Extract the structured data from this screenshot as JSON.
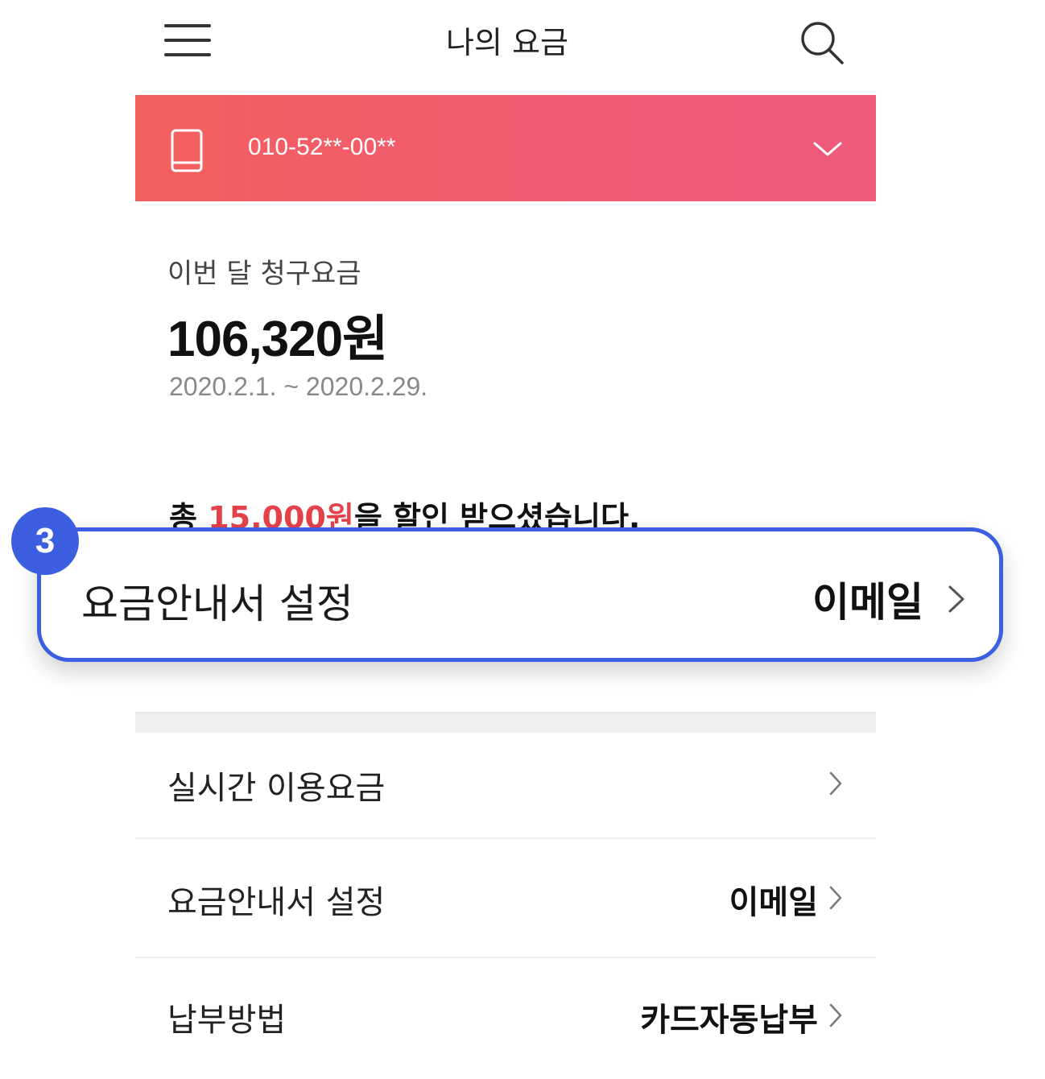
{
  "header": {
    "title": "나의 요금",
    "menu_icon": "hamburger-menu-icon",
    "search_icon": "search-icon"
  },
  "banner": {
    "phone_number": "010-52**-00**",
    "phone_icon": "smartphone-icon",
    "expand_icon": "chevron-down-icon",
    "color_start": "#f4605e",
    "color_end": "#f05a7c"
  },
  "summary": {
    "label": "이번 달 청구요금",
    "amount": "106,320원",
    "period": "2020.2.1. ~ 2020.2.29."
  },
  "discount": {
    "prefix": "총 ",
    "amount": "15,000원",
    "suffix": "을 할인 받으셨습니다."
  },
  "callout": {
    "step": "3",
    "label": "요금안내서 설정",
    "value": "이메일",
    "accent_color": "#3b5fe0"
  },
  "list": {
    "items": [
      {
        "label": "실시간 이용요금",
        "value": ""
      },
      {
        "label": "요금안내서 설정",
        "value": "이메일"
      },
      {
        "label": "납부방법",
        "value": "카드자동납부"
      }
    ]
  }
}
